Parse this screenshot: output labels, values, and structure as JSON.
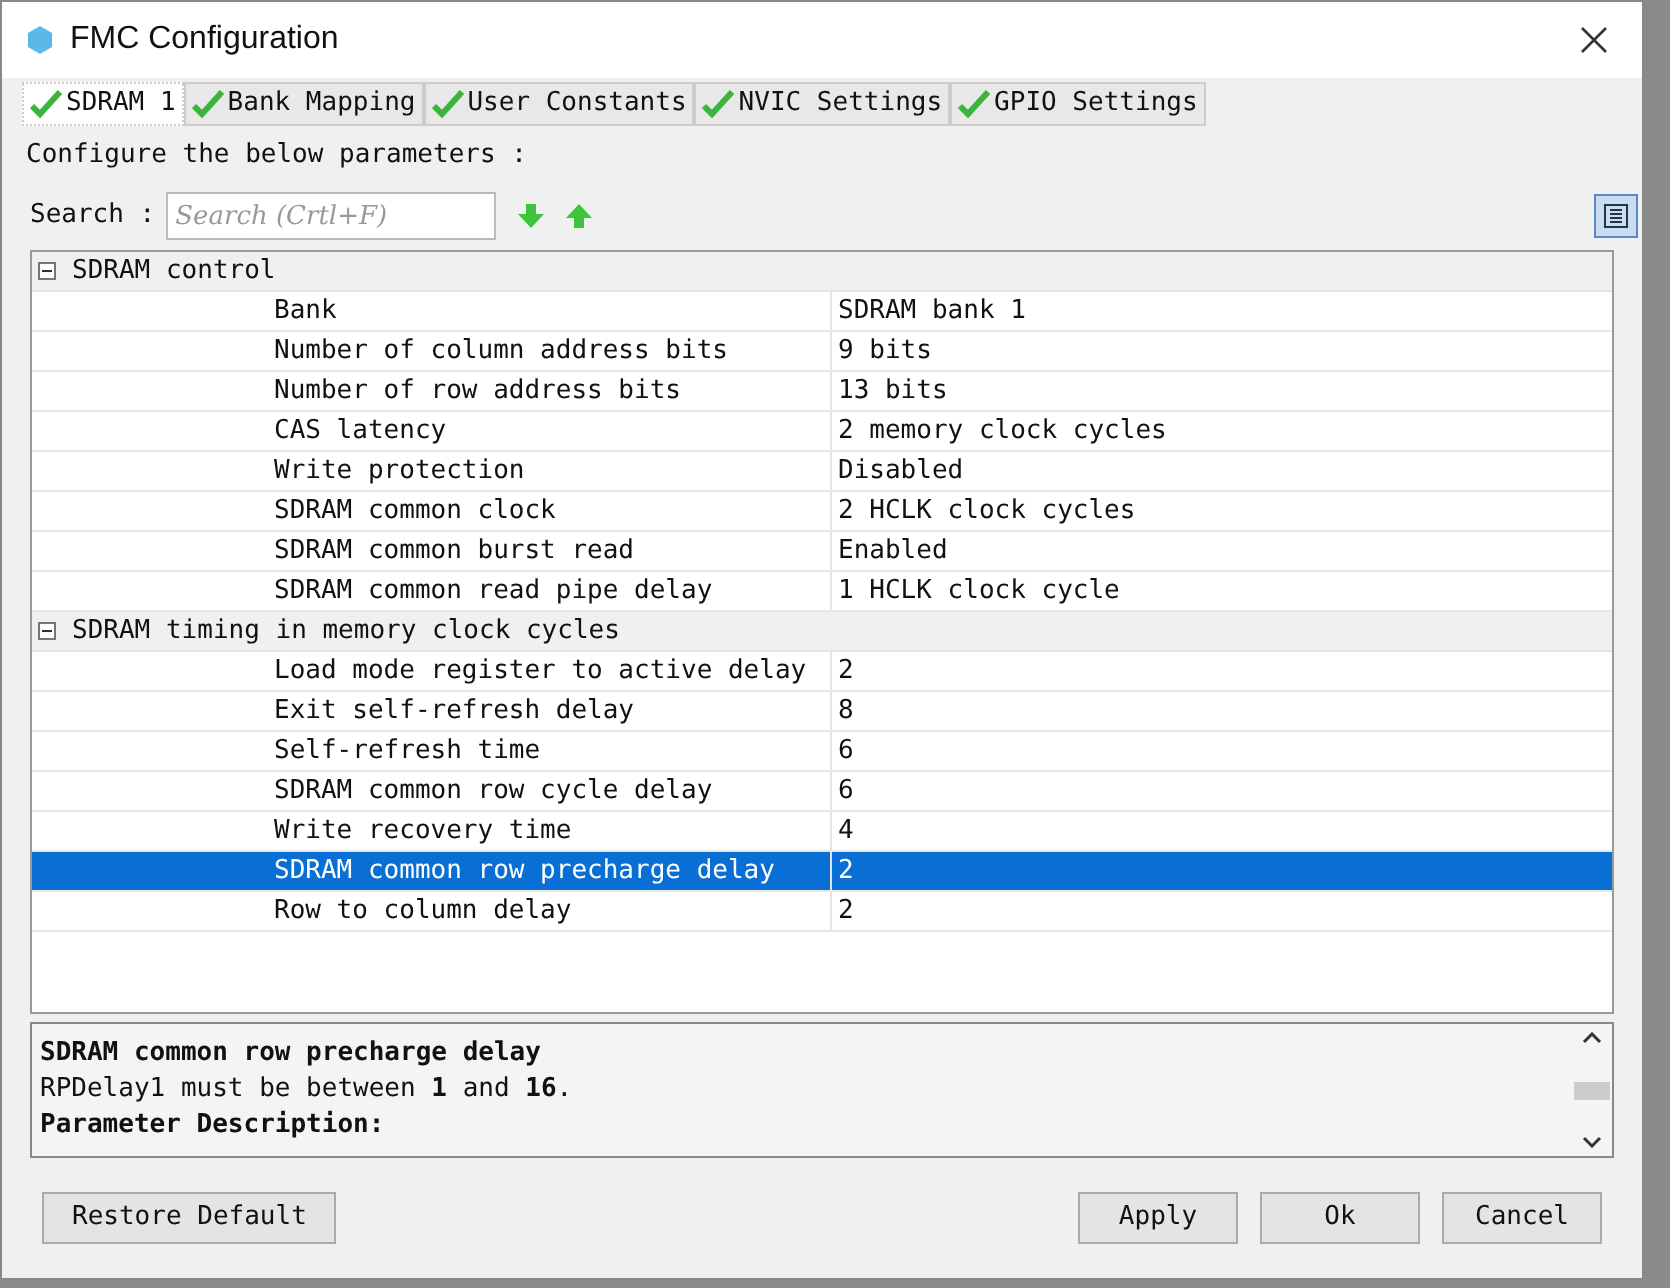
{
  "window": {
    "title": "FMC Configuration"
  },
  "tabs": [
    {
      "label": "SDRAM 1",
      "selected": true,
      "valid": true
    },
    {
      "label": "Bank Mapping",
      "selected": false,
      "valid": true
    },
    {
      "label": "User Constants",
      "selected": false,
      "valid": true
    },
    {
      "label": "NVIC Settings",
      "selected": false,
      "valid": true
    },
    {
      "label": "GPIO Settings",
      "selected": false,
      "valid": true
    }
  ],
  "instruction": "Configure the below parameters :",
  "search": {
    "label": "Search :",
    "placeholder": "Search (Crtl+F)"
  },
  "groups": [
    {
      "name": "SDRAM control",
      "expanded": true,
      "children": [
        {
          "name": "Bank",
          "value": "SDRAM bank 1",
          "selected": false
        },
        {
          "name": "Number of column address bits",
          "value": "9 bits",
          "selected": false
        },
        {
          "name": "Number of row address bits",
          "value": "13 bits",
          "selected": false
        },
        {
          "name": "CAS latency",
          "value": "2 memory clock cycles",
          "selected": false
        },
        {
          "name": "Write protection",
          "value": "Disabled",
          "selected": false
        },
        {
          "name": "SDRAM common clock",
          "value": "2 HCLK clock cycles",
          "selected": false
        },
        {
          "name": "SDRAM common burst read",
          "value": "Enabled",
          "selected": false
        },
        {
          "name": "SDRAM common read pipe delay",
          "value": "1 HCLK clock cycle",
          "selected": false
        }
      ]
    },
    {
      "name": "SDRAM timing in memory clock cycles",
      "expanded": true,
      "children": [
        {
          "name": "Load mode register to active delay",
          "value": "2",
          "selected": false
        },
        {
          "name": "Exit self-refresh delay",
          "value": "8",
          "selected": false
        },
        {
          "name": "Self-refresh time",
          "value": "6",
          "selected": false
        },
        {
          "name": "SDRAM common row cycle delay",
          "value": "6",
          "selected": false
        },
        {
          "name": "Write recovery time",
          "value": "4",
          "selected": false
        },
        {
          "name": "SDRAM common row precharge delay",
          "value": "2",
          "selected": true
        },
        {
          "name": "Row to column delay",
          "value": "2",
          "selected": false
        }
      ]
    }
  ],
  "description": {
    "title": "SDRAM common row precharge delay",
    "range": "RPDelay1 must be between **1** and **16**.",
    "heading": "Parameter Description:"
  },
  "buttons": {
    "left": [
      "Restore Default"
    ],
    "right": [
      "Apply",
      "Ok",
      "Cancel"
    ]
  }
}
